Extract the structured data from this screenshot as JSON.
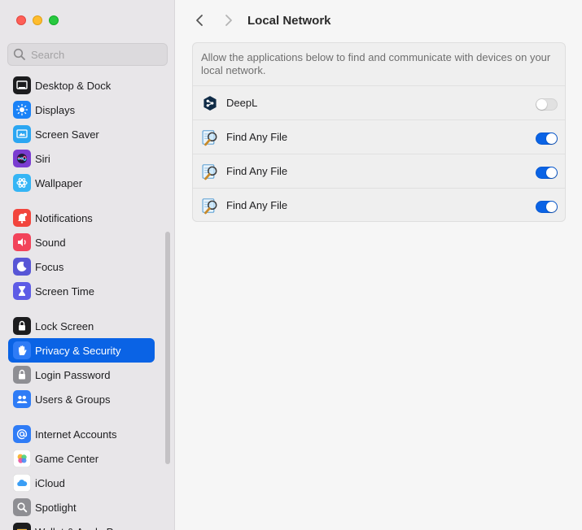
{
  "search": {
    "placeholder": "Search"
  },
  "sidebar": {
    "groups": [
      [
        {
          "label": "Desktop & Dock",
          "icon": "desktop-dock-icon",
          "color": "#1c1c1e"
        },
        {
          "label": "Displays",
          "icon": "displays-icon",
          "color": "#1a82f7"
        },
        {
          "label": "Screen Saver",
          "icon": "screen-saver-icon",
          "color": "#2ba6f2"
        },
        {
          "label": "Siri",
          "icon": "siri-icon",
          "color": "#7a3cd1"
        },
        {
          "label": "Wallpaper",
          "icon": "wallpaper-icon",
          "color": "#35b5f5"
        }
      ],
      [
        {
          "label": "Notifications",
          "icon": "notifications-icon",
          "color": "#f2453d"
        },
        {
          "label": "Sound",
          "icon": "sound-icon",
          "color": "#f2435a"
        },
        {
          "label": "Focus",
          "icon": "focus-icon",
          "color": "#5856d6"
        },
        {
          "label": "Screen Time",
          "icon": "screen-time-icon",
          "color": "#5e5ce6"
        }
      ],
      [
        {
          "label": "Lock Screen",
          "icon": "lock-screen-icon",
          "color": "#1c1c1e"
        },
        {
          "label": "Privacy & Security",
          "icon": "privacy-hand-icon",
          "color": "#2f7cf6",
          "selected": true
        },
        {
          "label": "Login Password",
          "icon": "lock-icon",
          "color": "#8e8e93"
        },
        {
          "label": "Users & Groups",
          "icon": "users-icon",
          "color": "#2f7cf6"
        }
      ],
      [
        {
          "label": "Internet Accounts",
          "icon": "at-icon",
          "color": "#2f7cf6"
        },
        {
          "label": "Game Center",
          "icon": "game-center-icon",
          "color": "#ffffff"
        },
        {
          "label": "iCloud",
          "icon": "icloud-icon",
          "color": "#ffffff"
        },
        {
          "label": "Spotlight",
          "icon": "spotlight-icon",
          "color": "#8e8e93"
        },
        {
          "label": "Wallet & Apple Pay",
          "icon": "wallet-icon",
          "color": "#1c1c1e"
        }
      ]
    ]
  },
  "header": {
    "title": "Local Network"
  },
  "panel": {
    "description": "Allow the applications below to find and communicate with devices on your local network.",
    "apps": [
      {
        "name": "DeepL",
        "icon": "deepl-icon",
        "enabled": false
      },
      {
        "name": "Find Any File",
        "icon": "find-any-file-icon",
        "enabled": true
      },
      {
        "name": "Find Any File",
        "icon": "find-any-file-icon",
        "enabled": true
      },
      {
        "name": "Find Any File",
        "icon": "find-any-file-icon",
        "enabled": true
      }
    ]
  },
  "colors": {
    "accent": "#0a63e5",
    "sidebar_bg": "#e8e6e9",
    "content_bg": "#f6f6f6"
  }
}
